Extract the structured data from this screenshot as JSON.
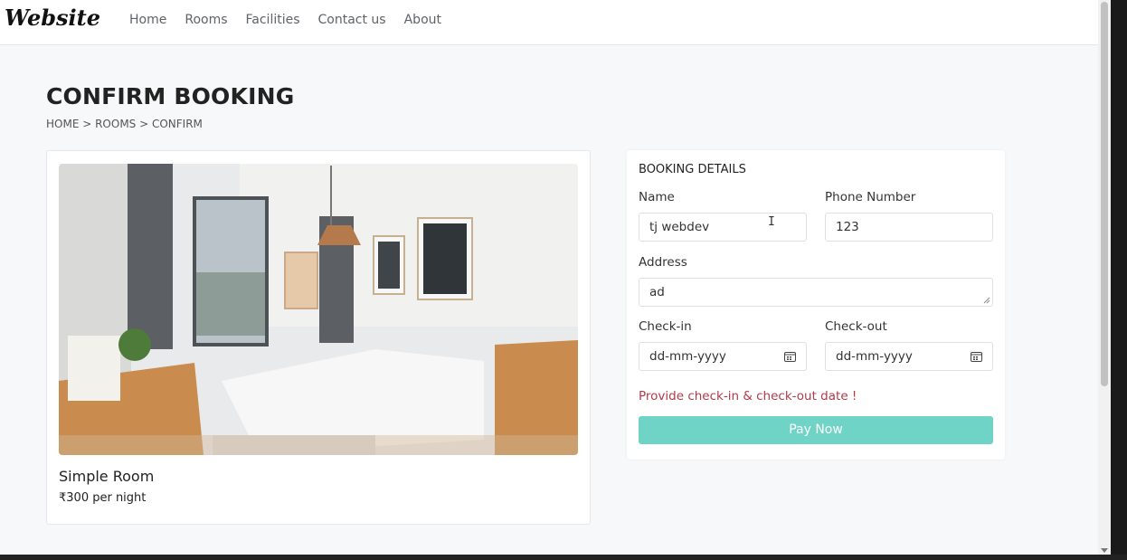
{
  "navbar": {
    "brand": "Website",
    "links": [
      "Home",
      "Rooms",
      "Facilities",
      "Contact us",
      "About"
    ]
  },
  "page": {
    "title": "CONFIRM BOOKING",
    "breadcrumb": "HOME > ROOMS > CONFIRM"
  },
  "room": {
    "name": "Simple Room",
    "price": "₹300 per night"
  },
  "booking": {
    "section_title": "BOOKING DETAILS",
    "name_label": "Name",
    "name_value": "tj webdev",
    "phone_label": "Phone Number",
    "phone_value": "123",
    "address_label": "Address",
    "address_value": "ad",
    "checkin_label": "Check-in",
    "checkin_value": "dd-mm-yyyy",
    "checkout_label": "Check-out",
    "checkout_value": "dd-mm-yyyy",
    "error": "Provide check-in & check-out date !",
    "pay_label": "Pay Now"
  },
  "colors": {
    "accent": "#6fd3c6",
    "error": "#b23a48",
    "background": "#f7f8fa"
  },
  "icons": [
    "calendar-icon",
    "text-cursor-icon"
  ]
}
